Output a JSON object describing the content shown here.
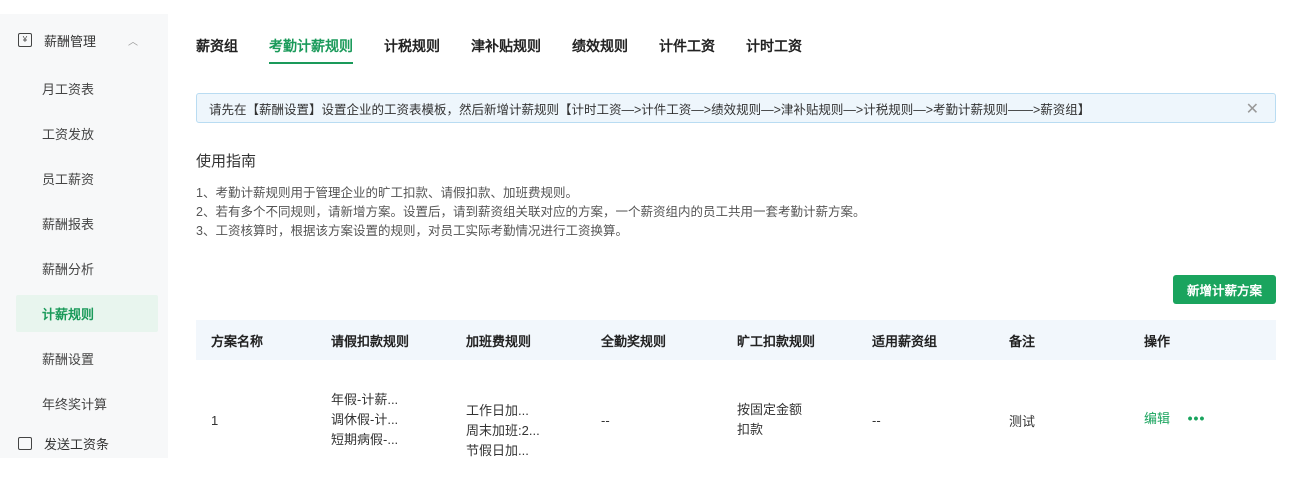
{
  "sidebar": {
    "header": {
      "label": "薪酬管理"
    },
    "items": [
      {
        "label": "月工资表"
      },
      {
        "label": "工资发放"
      },
      {
        "label": "员工薪资"
      },
      {
        "label": "薪酬报表"
      },
      {
        "label": "薪酬分析"
      },
      {
        "label": "计薪规则"
      },
      {
        "label": "薪酬设置"
      },
      {
        "label": "年终奖计算"
      }
    ],
    "footer": {
      "label": "发送工资条"
    }
  },
  "tabs": [
    {
      "label": "薪资组"
    },
    {
      "label": "考勤计薪规则"
    },
    {
      "label": "计税规则"
    },
    {
      "label": "津补贴规则"
    },
    {
      "label": "绩效规则"
    },
    {
      "label": "计件工资"
    },
    {
      "label": "计时工资"
    }
  ],
  "notice": {
    "text": "请先在【薪酬设置】设置企业的工资表模板，然后新增计薪规则【计时工资—>计件工资—>绩效规则—>津补贴规则—>计税规则—>考勤计薪规则——>薪资组】",
    "close": "✕"
  },
  "guide": {
    "title": "使用指南",
    "lines": [
      "1、考勤计薪规则用于管理企业的旷工扣款、请假扣款、加班费规则。",
      "2、若有多个不同规则，请新增方案。设置后，请到薪资组关联对应的方案，一个薪资组内的员工共用一套考勤计薪方案。",
      "3、工资核算时，根据该方案设置的规则，对员工实际考勤情况进行工资换算。"
    ]
  },
  "add_button": {
    "label": "新增计薪方案"
  },
  "table": {
    "headers": [
      "方案名称",
      "请假扣款规则",
      "加班费规则",
      "全勤奖规则",
      "旷工扣款规则",
      "适用薪资组",
      "备注",
      "操作"
    ],
    "rows": [
      {
        "name": "1",
        "leave": [
          "年假-计薪...",
          "调休假-计...",
          "短期病假-..."
        ],
        "overtime": [
          "工作日加...",
          "周末加班:2...",
          "节假日加..."
        ],
        "attendance": "--",
        "absence": [
          "按固定金额",
          "扣款"
        ],
        "groups": "--",
        "remark": "测试",
        "edit": "编辑",
        "more": "•••"
      }
    ]
  }
}
